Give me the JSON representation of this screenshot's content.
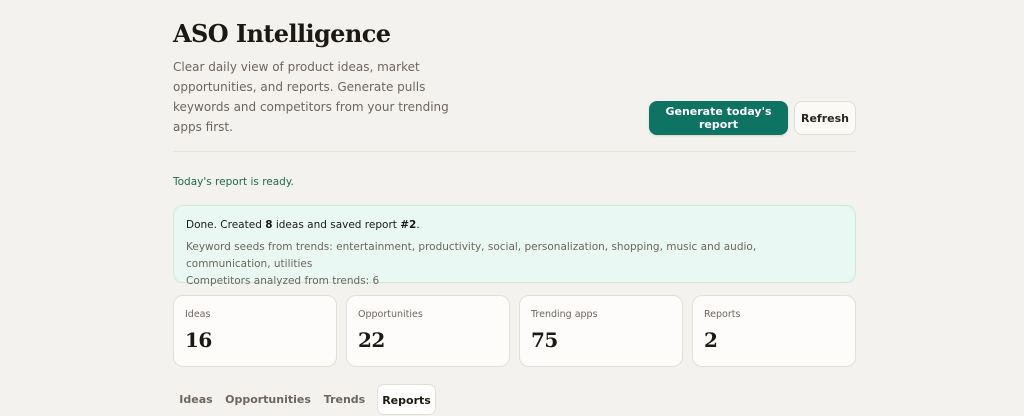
{
  "header": {
    "title": "ASO Intelligence",
    "subtitle": "Clear daily view of product ideas, market opportunities, and reports. Generate pulls keywords and competitors from your trending apps first.",
    "generate_label": "Generate today's report",
    "refresh_label": "Refresh"
  },
  "status": {
    "text": "Today's report is ready."
  },
  "result": {
    "prefix": "Done. Created ",
    "ideas_count": "8",
    "middle": " ideas and saved report ",
    "report_id": "#2",
    "suffix": ".",
    "keyword_seeds": "Keyword seeds from trends: entertainment, productivity, social, personalization, shopping, music and audio, communication, utilities",
    "competitors": "Competitors analyzed from trends: 6"
  },
  "stats": [
    {
      "label": "Ideas",
      "value": "16"
    },
    {
      "label": "Opportunities",
      "value": "22"
    },
    {
      "label": "Trending apps",
      "value": "75"
    },
    {
      "label": "Reports",
      "value": "2"
    }
  ],
  "tabs": [
    {
      "label": "Ideas",
      "active": false
    },
    {
      "label": "Opportunities",
      "active": false
    },
    {
      "label": "Trends",
      "active": false
    },
    {
      "label": "Reports",
      "active": true
    }
  ],
  "colors": {
    "accent": "#0f7364",
    "status_text": "#1f6b4d",
    "success_panel_bg": "#eaf8f3",
    "page_bg": "#f4f2ee"
  }
}
